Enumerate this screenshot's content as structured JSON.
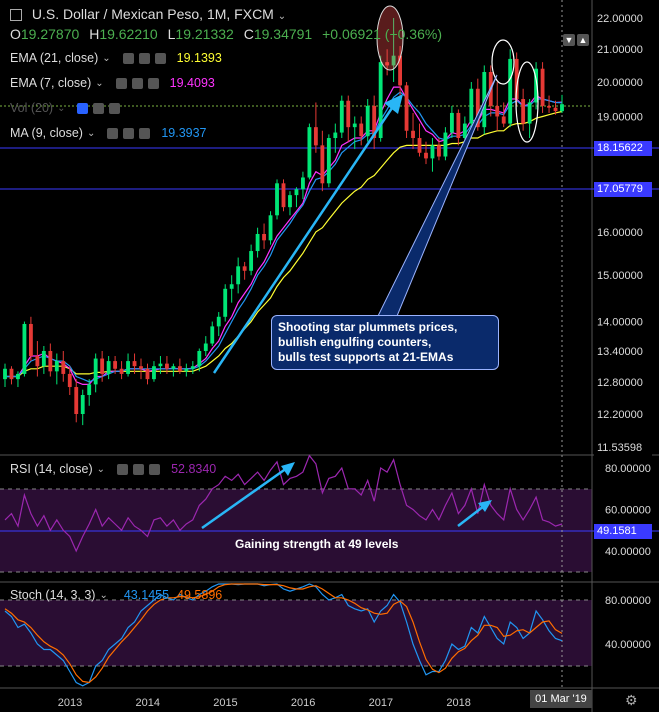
{
  "header": {
    "title": "U.S. Dollar / Mexican Peso, 1M, FXCM",
    "ohlc": {
      "o_label": "O",
      "o": "19.27870",
      "h_label": "H",
      "h": "19.62210",
      "l_label": "L",
      "l": "19.21332",
      "c_label": "C",
      "c": "19.34791",
      "change": "+0.06921 (+0.36%)"
    }
  },
  "indicators": [
    {
      "label": "EMA (21, close)",
      "value": "19.1393",
      "color": "#ffff33"
    },
    {
      "label": "EMA (7, close)",
      "value": "19.4093",
      "color": "#ff33ff"
    },
    {
      "label": "Vol (20)",
      "value": "",
      "color": "#555555"
    },
    {
      "label": "MA (9, close)",
      "value": "19.3937",
      "color": "#2196f3"
    }
  ],
  "rsi": {
    "label": "RSI (14, close)",
    "value": "52.8340",
    "color": "#9c27b0"
  },
  "stoch": {
    "label": "Stoch (14, 3, 3)",
    "k_value": "43.1455",
    "d_value": "49.5896",
    "k_color": "#2196f3",
    "d_color": "#ff6d00"
  },
  "annotations": {
    "callout": [
      "Shooting star plummets prices,",
      "bullish engulfing counters,",
      "bulls test supports at 21-EMAs"
    ],
    "rsi_note": "Gaining strength at 49 levels"
  },
  "price_tags": {
    "support1": "18.15622",
    "support2": "17.05779",
    "low": "11.53598",
    "rsi_value": "49.1581"
  },
  "date_label": "01 Mar '19",
  "chart_data": {
    "type": "candlestick",
    "price_axis": {
      "ticks": [
        "22.00000",
        "21.00000",
        "20.00000",
        "19.00000",
        "16.00000",
        "15.00000",
        "14.00000",
        "13.40000",
        "12.80000",
        "12.20000"
      ],
      "tick_values": [
        22,
        21,
        20,
        19,
        16,
        15,
        14,
        13.4,
        12.8,
        12.2
      ],
      "log_scale": true
    },
    "x_ticks": [
      "2013",
      "2014",
      "2015",
      "2016",
      "2017",
      "2018"
    ],
    "candles": [
      [
        12.85,
        13.15,
        12.7,
        13.05
      ],
      [
        13.05,
        13.1,
        12.75,
        12.85
      ],
      [
        12.85,
        13.0,
        12.7,
        12.95
      ],
      [
        12.95,
        14.0,
        12.9,
        13.95
      ],
      [
        13.95,
        14.1,
        13.2,
        13.3
      ],
      [
        13.3,
        13.6,
        12.9,
        13.1
      ],
      [
        13.1,
        13.5,
        12.95,
        13.4
      ],
      [
        13.4,
        13.55,
        12.9,
        13.0
      ],
      [
        13.0,
        13.35,
        12.75,
        13.2
      ],
      [
        13.2,
        13.4,
        12.8,
        12.95
      ],
      [
        12.95,
        13.1,
        12.55,
        12.7
      ],
      [
        12.7,
        12.85,
        12.05,
        12.2
      ],
      [
        12.2,
        12.65,
        12.0,
        12.55
      ],
      [
        12.55,
        12.85,
        12.35,
        12.75
      ],
      [
        12.75,
        13.35,
        12.6,
        13.25
      ],
      [
        13.25,
        13.4,
        12.8,
        12.95
      ],
      [
        12.95,
        13.3,
        12.85,
        13.2
      ],
      [
        13.2,
        13.3,
        12.95,
        13.05
      ],
      [
        13.05,
        13.2,
        12.85,
        12.95
      ],
      [
        12.95,
        13.35,
        12.9,
        13.2
      ],
      [
        13.2,
        13.35,
        12.95,
        13.1
      ],
      [
        13.1,
        13.25,
        12.85,
        13.05
      ],
      [
        13.05,
        13.15,
        12.75,
        12.85
      ],
      [
        12.85,
        13.2,
        12.8,
        13.1
      ],
      [
        13.1,
        13.3,
        12.95,
        13.15
      ],
      [
        13.15,
        13.3,
        12.95,
        13.05
      ],
      [
        13.05,
        13.15,
        12.9,
        13.1
      ],
      [
        13.1,
        13.25,
        12.95,
        13.0
      ],
      [
        13.0,
        13.15,
        12.9,
        13.05
      ],
      [
        13.05,
        13.2,
        12.95,
        13.1
      ],
      [
        13.1,
        13.45,
        13.0,
        13.4
      ],
      [
        13.4,
        13.7,
        13.3,
        13.55
      ],
      [
        13.55,
        14.0,
        13.5,
        13.9
      ],
      [
        13.9,
        14.2,
        13.7,
        14.1
      ],
      [
        14.1,
        14.8,
        14.0,
        14.7
      ],
      [
        14.7,
        15.0,
        14.4,
        14.8
      ],
      [
        14.8,
        15.4,
        14.6,
        15.2
      ],
      [
        15.2,
        15.3,
        14.9,
        15.1
      ],
      [
        15.1,
        15.7,
        15.0,
        15.55
      ],
      [
        15.55,
        16.1,
        15.4,
        15.95
      ],
      [
        15.95,
        16.2,
        15.6,
        15.8
      ],
      [
        15.8,
        16.5,
        15.7,
        16.4
      ],
      [
        16.4,
        17.3,
        16.3,
        17.2
      ],
      [
        17.2,
        17.3,
        16.5,
        16.6
      ],
      [
        16.6,
        17.0,
        16.4,
        16.9
      ],
      [
        16.9,
        17.1,
        16.6,
        17.05
      ],
      [
        17.05,
        17.5,
        16.8,
        17.35
      ],
      [
        17.35,
        18.8,
        17.3,
        18.7
      ],
      [
        18.7,
        19.4,
        18.0,
        18.2
      ],
      [
        18.2,
        18.6,
        17.0,
        17.2
      ],
      [
        17.2,
        18.5,
        17.1,
        18.4
      ],
      [
        18.4,
        18.8,
        18.0,
        18.55
      ],
      [
        18.55,
        19.6,
        18.4,
        19.45
      ],
      [
        19.45,
        19.6,
        18.3,
        18.7
      ],
      [
        18.7,
        19.0,
        18.1,
        18.8
      ],
      [
        18.8,
        19.0,
        18.2,
        18.45
      ],
      [
        18.45,
        19.5,
        18.3,
        19.3
      ],
      [
        19.3,
        19.6,
        18.1,
        18.4
      ],
      [
        18.4,
        20.8,
        18.3,
        20.6
      ],
      [
        20.6,
        21.0,
        20.2,
        20.5
      ],
      [
        20.5,
        22.0,
        20.0,
        20.8
      ],
      [
        20.8,
        21.1,
        19.4,
        19.9
      ],
      [
        19.9,
        20.0,
        18.4,
        18.6
      ],
      [
        18.6,
        19.1,
        18.1,
        18.4
      ],
      [
        18.4,
        18.8,
        17.9,
        18.0
      ],
      [
        18.0,
        18.3,
        17.7,
        17.85
      ],
      [
        17.85,
        18.4,
        17.5,
        18.2
      ],
      [
        18.2,
        18.4,
        17.8,
        17.9
      ],
      [
        17.9,
        18.7,
        17.8,
        18.55
      ],
      [
        18.55,
        19.3,
        18.4,
        19.1
      ],
      [
        19.1,
        19.2,
        18.2,
        18.4
      ],
      [
        18.4,
        19.0,
        18.3,
        18.8
      ],
      [
        18.8,
        20.0,
        18.7,
        19.8
      ],
      [
        19.8,
        20.1,
        18.6,
        18.7
      ],
      [
        18.7,
        20.5,
        18.5,
        20.3
      ],
      [
        20.3,
        20.5,
        19.0,
        19.3
      ],
      [
        19.3,
        20.0,
        18.6,
        19.0
      ],
      [
        19.0,
        19.4,
        18.7,
        18.8
      ],
      [
        18.8,
        21.0,
        18.7,
        20.7
      ],
      [
        20.7,
        20.9,
        19.3,
        19.5
      ],
      [
        19.5,
        19.8,
        18.6,
        18.8
      ],
      [
        18.8,
        19.5,
        18.4,
        19.4
      ],
      [
        19.4,
        20.6,
        19.2,
        20.4
      ],
      [
        20.4,
        20.6,
        19.1,
        19.3
      ],
      [
        19.3,
        19.6,
        19.1,
        19.25
      ],
      [
        19.25,
        19.45,
        19.05,
        19.15
      ],
      [
        19.15,
        19.62,
        19.1,
        19.35
      ]
    ],
    "ema21": [
      12.9,
      12.9,
      12.9,
      13.0,
      13.05,
      13.05,
      13.1,
      13.1,
      13.1,
      13.1,
      13.05,
      12.95,
      12.95,
      12.95,
      12.98,
      12.98,
      13.0,
      13.0,
      13.0,
      13.0,
      13.0,
      13.0,
      13.0,
      13.0,
      13.0,
      13.0,
      13.0,
      13.0,
      13.0,
      13.0,
      13.05,
      13.1,
      13.2,
      13.3,
      13.45,
      13.55,
      13.7,
      13.85,
      14.0,
      14.2,
      14.35,
      14.5,
      14.75,
      14.95,
      15.1,
      15.3,
      15.5,
      15.75,
      16.0,
      16.1,
      16.3,
      16.5,
      16.7,
      16.85,
      17.0,
      17.1,
      17.3,
      17.4,
      17.6,
      17.8,
      18.0,
      18.15,
      18.2,
      18.2,
      18.2,
      18.2,
      18.2,
      18.2,
      18.2,
      18.25,
      18.25,
      18.3,
      18.4,
      18.4,
      18.5,
      18.55,
      18.6,
      18.6,
      18.75,
      18.8,
      18.8,
      18.85,
      18.95,
      19.0,
      19.05,
      19.1,
      19.14
    ],
    "ema7": [
      12.9,
      12.9,
      12.9,
      13.1,
      13.3,
      13.3,
      13.35,
      13.25,
      13.2,
      13.15,
      13.05,
      12.8,
      12.75,
      12.75,
      12.9,
      12.9,
      13.0,
      13.0,
      13.0,
      13.05,
      13.05,
      13.05,
      13.0,
      13.02,
      13.05,
      13.05,
      13.06,
      13.05,
      13.05,
      13.06,
      13.15,
      13.25,
      13.45,
      13.6,
      13.9,
      14.1,
      14.4,
      14.6,
      14.8,
      15.1,
      15.3,
      15.6,
      15.9,
      16.1,
      16.3,
      16.5,
      16.7,
      17.2,
      17.5,
      17.4,
      17.6,
      17.8,
      18.2,
      18.3,
      18.4,
      18.4,
      18.6,
      18.6,
      19.1,
      19.5,
      19.85,
      19.85,
      19.5,
      19.2,
      18.9,
      18.6,
      18.5,
      18.3,
      18.35,
      18.55,
      18.5,
      18.6,
      18.9,
      18.85,
      19.2,
      19.2,
      19.15,
      19.1,
      19.5,
      19.5,
      19.3,
      19.35,
      19.6,
      19.5,
      19.45,
      19.4,
      19.41
    ],
    "ma9": [
      12.9,
      12.9,
      12.9,
      13.05,
      13.2,
      13.25,
      13.3,
      13.25,
      13.2,
      13.2,
      13.1,
      12.9,
      12.85,
      12.8,
      12.85,
      12.9,
      12.95,
      13.0,
      13.0,
      13.05,
      13.05,
      13.05,
      13.05,
      13.05,
      13.05,
      13.05,
      13.05,
      13.05,
      13.05,
      13.05,
      13.1,
      13.2,
      13.35,
      13.5,
      13.75,
      14.0,
      14.25,
      14.45,
      14.7,
      15.0,
      15.2,
      15.45,
      15.8,
      16.0,
      16.2,
      16.45,
      16.65,
      17.0,
      17.3,
      17.35,
      17.5,
      17.7,
      18.0,
      18.15,
      18.3,
      18.35,
      18.5,
      18.55,
      18.9,
      19.2,
      19.55,
      19.7,
      19.55,
      19.3,
      19.1,
      18.8,
      18.6,
      18.4,
      18.35,
      18.45,
      18.45,
      18.5,
      18.75,
      18.75,
      19.0,
      19.1,
      19.1,
      19.05,
      19.35,
      19.45,
      19.3,
      19.3,
      19.5,
      19.5,
      19.45,
      19.4,
      19.39
    ],
    "rsi_levels": [
      70,
      30
    ],
    "rsi_ticks": [
      "80.00000",
      "60.00000",
      "40.00000"
    ],
    "rsi_tick_values": [
      80,
      60,
      40
    ],
    "rsi": [
      55,
      58,
      52,
      67,
      58,
      52,
      57,
      50,
      55,
      50,
      47,
      40,
      47,
      53,
      60,
      52,
      56,
      53,
      50,
      56,
      52,
      50,
      47,
      55,
      56,
      52,
      55,
      50,
      53,
      55,
      62,
      65,
      70,
      72,
      76,
      74,
      77,
      72,
      75,
      78,
      74,
      79,
      83,
      72,
      75,
      76,
      78,
      86,
      82,
      68,
      75,
      76,
      80,
      70,
      70,
      67,
      74,
      64,
      80,
      78,
      84,
      72,
      62,
      60,
      57,
      55,
      60,
      55,
      62,
      68,
      58,
      62,
      70,
      58,
      72,
      62,
      58,
      55,
      70,
      60,
      55,
      60,
      66,
      55,
      54,
      52,
      53
    ],
    "stoch_levels": [
      80,
      20
    ],
    "stoch_ticks": [
      "80.00000",
      "40.00000"
    ],
    "stoch_tick_values": [
      80,
      40
    ],
    "stoch_k": [
      70,
      65,
      55,
      58,
      50,
      40,
      35,
      35,
      30,
      25,
      15,
      5,
      2,
      5,
      20,
      25,
      35,
      40,
      45,
      55,
      60,
      70,
      75,
      80,
      85,
      82,
      80,
      85,
      82,
      80,
      85,
      88,
      92,
      95,
      96,
      95,
      94,
      95,
      96,
      95,
      93,
      94,
      95,
      90,
      88,
      90,
      92,
      95,
      92,
      85,
      80,
      82,
      85,
      75,
      72,
      70,
      72,
      60,
      70,
      75,
      85,
      78,
      60,
      40,
      25,
      12,
      15,
      15,
      25,
      40,
      35,
      38,
      55,
      50,
      65,
      55,
      45,
      40,
      60,
      55,
      45,
      50,
      70,
      62,
      52,
      45,
      43
    ],
    "stoch_d": [
      72,
      68,
      62,
      60,
      55,
      48,
      42,
      38,
      35,
      30,
      22,
      12,
      6,
      5,
      10,
      18,
      28,
      35,
      42,
      48,
      55,
      62,
      70,
      76,
      80,
      82,
      82,
      83,
      83,
      82,
      83,
      85,
      88,
      92,
      94,
      95,
      95,
      95,
      95,
      95,
      94,
      94,
      94,
      93,
      91,
      90,
      90,
      92,
      93,
      90,
      86,
      82,
      82,
      80,
      77,
      73,
      71,
      68,
      67,
      68,
      76,
      79,
      74,
      60,
      42,
      26,
      17,
      14,
      18,
      27,
      33,
      36,
      43,
      48,
      57,
      57,
      55,
      47,
      48,
      52,
      53,
      50,
      55,
      60,
      61,
      53,
      49.6
    ]
  }
}
